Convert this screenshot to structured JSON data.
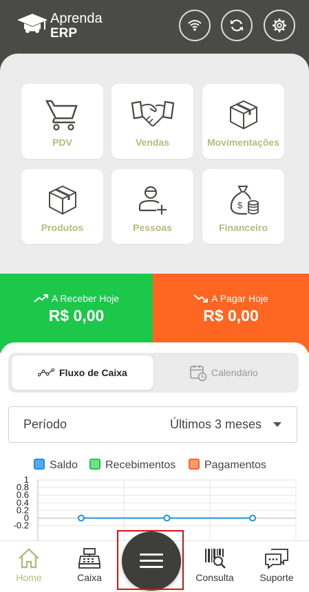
{
  "brand": {
    "line1": "Aprenda",
    "line2": "ERP"
  },
  "header_actions": [
    {
      "icon": "wifi-icon"
    },
    {
      "icon": "sync-icon"
    },
    {
      "icon": "gear-icon"
    }
  ],
  "tiles": [
    {
      "label": "PDV",
      "icon": "cart-icon"
    },
    {
      "label": "Vendas",
      "icon": "handshake-icon"
    },
    {
      "label": "Movimentações",
      "icon": "box-icon"
    },
    {
      "label": "Produtos",
      "icon": "box-icon"
    },
    {
      "label": "Pessoas",
      "icon": "person-add-icon"
    },
    {
      "label": "Financeiro",
      "icon": "money-bag-icon"
    }
  ],
  "cards": {
    "receive": {
      "title": "A Receber Hoje",
      "value": "R$ 0,00",
      "color": "#1dc74a"
    },
    "pay": {
      "title": "A Pagar Hoje",
      "value": "R$ 0,00",
      "color": "#fe6621"
    }
  },
  "tabs": {
    "active": "Fluxo de Caixa",
    "inactive": "Calendário"
  },
  "period": {
    "label": "Período",
    "value": "Últimos 3 meses"
  },
  "chart_data": {
    "type": "line",
    "series": [
      {
        "name": "Saldo",
        "color": "#1f8fe0",
        "values": [
          0,
          0,
          0
        ]
      },
      {
        "name": "Recebimentos",
        "color": "#1dc74a",
        "values": []
      },
      {
        "name": "Pagamentos",
        "color": "#fe6621",
        "values": []
      }
    ],
    "yticks": [
      "1",
      "0.8",
      "0.6",
      "0.4",
      "0.2",
      "0",
      "-0.2"
    ],
    "ylim": [
      -0.2,
      1
    ],
    "legend": "top"
  },
  "nav": [
    {
      "label": "Home",
      "icon": "home-icon",
      "active": true
    },
    {
      "label": "Caixa",
      "icon": "cash-register-icon"
    },
    {
      "label": "",
      "icon": "menu-icon"
    },
    {
      "label": "Consulta",
      "icon": "barcode-search-icon"
    },
    {
      "label": "Suporte",
      "icon": "chat-icon"
    }
  ],
  "colors": {
    "header": "#4a4a46",
    "tile_label": "#b8ba7a",
    "nav_active": "#b8ba7a"
  }
}
